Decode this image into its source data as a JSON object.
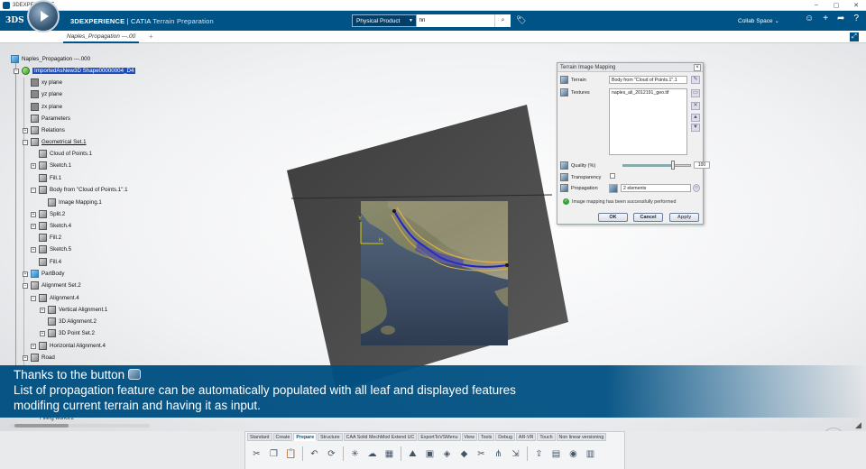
{
  "window": {
    "title": "3DEXPERIENCE",
    "controls": [
      "–",
      "▢",
      "✕"
    ]
  },
  "appbar": {
    "logo": "3DS",
    "brand_bold": "3DEXPERIENCE",
    "brand_app": " | CATIA",
    "brand_module": " Terrain Preparation",
    "search_scope": "Physical Product",
    "search_placeholder": "fin",
    "collab_space": "Collab Space",
    "colors": {
      "bar": "#005386",
      "accent": "#1f4fbf"
    }
  },
  "tabs": {
    "main": "Naples_Propagation ---.00",
    "add": "+"
  },
  "tree": {
    "root": "Naples_Propagation ---.000",
    "items": [
      {
        "label": "ImportedAsNew3D Shape00000004_D4",
        "selected": true
      },
      {
        "label": "xy plane"
      },
      {
        "label": "yz plane"
      },
      {
        "label": "zx plane"
      },
      {
        "label": "Parameters"
      },
      {
        "label": "Relations"
      },
      {
        "label": "Geometrical Set.1"
      },
      {
        "label": "Cloud of Points.1"
      },
      {
        "label": "Sketch.1"
      },
      {
        "label": "Fill.1"
      },
      {
        "label": "Body from \"Cloud of Points.1\".1"
      },
      {
        "label": "Image Mapping.1"
      },
      {
        "label": "Split.2"
      },
      {
        "label": "Sketch.4"
      },
      {
        "label": "Fill.2"
      },
      {
        "label": "Sketch.5"
      },
      {
        "label": "Fill.4"
      },
      {
        "label": "PartBody"
      },
      {
        "label": "Alignment Set.2"
      },
      {
        "label": "Alignment.4"
      },
      {
        "label": "Vertical Alignment.1"
      },
      {
        "label": "3D Alignment.2"
      },
      {
        "label": "3D Point Set.2"
      },
      {
        "label": "Horizontal Alignment.4"
      },
      {
        "label": "Road"
      }
    ],
    "ghost_item": "Filling works.2"
  },
  "dialog": {
    "title": "Terrain Image Mapping",
    "terrain_label": "Terrain",
    "terrain_value": "Body from \"Cloud of Points.1\".1",
    "textures_label": "Textures",
    "textures_value": "naples_ali_2012191_geo.tif",
    "quality_label": "Quality (%)",
    "quality_value": "100",
    "quality_fraction": 1.0,
    "transparency_label": "Transparency",
    "propagation_label": "Propagation",
    "propagation_value": "2 elements",
    "message": "Image mapping has been successfully performed",
    "ok": "OK",
    "cancel": "Cancel",
    "apply": "Apply"
  },
  "caption": {
    "line1": "Thanks to the button",
    "line2": "List of propagation feature can be automatically populated with all leaf and displayed features",
    "line3": "modifing current terrain  and having it as input."
  },
  "action_bar": {
    "tabs": [
      "Standard",
      "Create",
      "Prepare",
      "Structure",
      "CAA Solid MechMod Extend UC",
      "ExportToVSMenu",
      "View",
      "Tools",
      "Debug",
      "AR-VR",
      "Touch",
      "Non linear versioning"
    ],
    "active_tab": "Prepare",
    "icons": [
      "cut-icon",
      "copy-icon",
      "paste-icon",
      "undo-icon",
      "update-icon",
      "point-icon",
      "cloud-icon",
      "mesh-icon",
      "terrain-icon",
      "image-mapping-icon",
      "fill-icon",
      "shape-icon",
      "split-icon",
      "trim-icon",
      "offset-icon",
      "export-icon",
      "grid-icon",
      "analysis-icon",
      "section-icon"
    ]
  }
}
